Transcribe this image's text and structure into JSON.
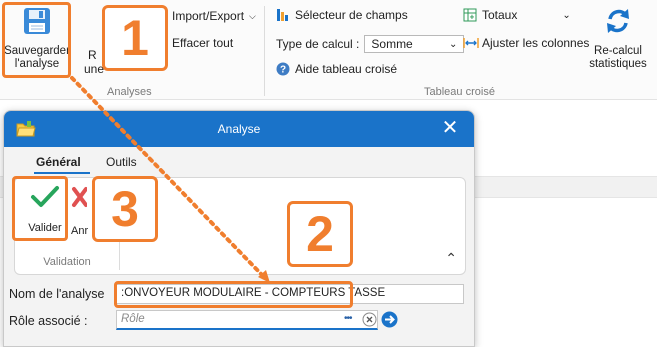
{
  "ribbon": {
    "save_label_1": "Sauvegarder",
    "save_label_2": "l'analyse",
    "partial_r": "R",
    "partial_une": "une",
    "import_export": "Import/Export",
    "clear_all": "Effacer tout",
    "group_analyses": "Analyses",
    "field_selector": "Sélecteur de champs",
    "totals": "Totaux",
    "calc_type_label": "Type de calcul :",
    "calc_type_value": "Somme",
    "adjust_columns": "Ajuster les colonnes",
    "pivot_help": "Aide tableau croisé",
    "recalc_1": "Re-calcul",
    "recalc_2": "statistiques",
    "group_pivot": "Tableau croisé"
  },
  "dialog": {
    "title": "Analyse",
    "tabs": [
      "Général",
      "Outils"
    ],
    "validate_label": "Valider",
    "cancel_partial": "Anr",
    "group_validation": "Validation",
    "analysis_name_label": "Nom de l'analyse",
    "analysis_name_value": ":ONVOYEUR MODULAIRE - COMPTEURS TASSE",
    "role_label": "Rôle associé :",
    "role_placeholder": "Rôle",
    "role_dots": "•••"
  },
  "callouts": [
    "1",
    "2",
    "3"
  ],
  "colors": {
    "accent": "#f07e2e",
    "titlebar": "#1a73c9",
    "validate_check": "#27a55c",
    "cancel_x": "#e05151"
  }
}
